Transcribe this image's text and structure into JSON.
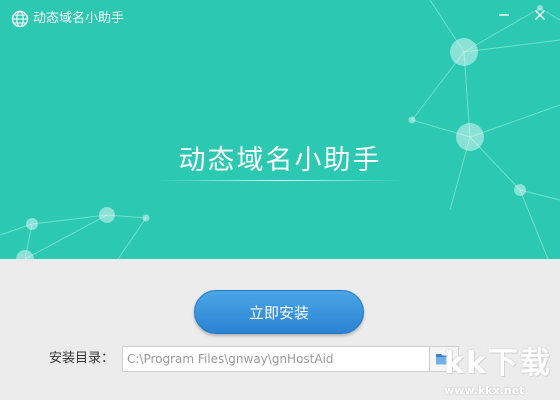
{
  "window": {
    "title": "动态域名小助手"
  },
  "hero": {
    "title": "动态域名小助手"
  },
  "install": {
    "button_label": "立即安装",
    "dir_label": "安装目录：",
    "dir_value": "C:\\Program Files\\gnway\\gnHostAid"
  },
  "watermark": {
    "text": "kk下载",
    "url": "www.kkx.net"
  },
  "icons": {
    "app": "globe-icon",
    "minimize": "minimize-icon",
    "close": "close-icon",
    "browse": "folder-icon"
  },
  "colors": {
    "hero_bg": "#2bc9b2",
    "button_blue": "#2a83d3",
    "bottom_bg": "#ececec"
  }
}
